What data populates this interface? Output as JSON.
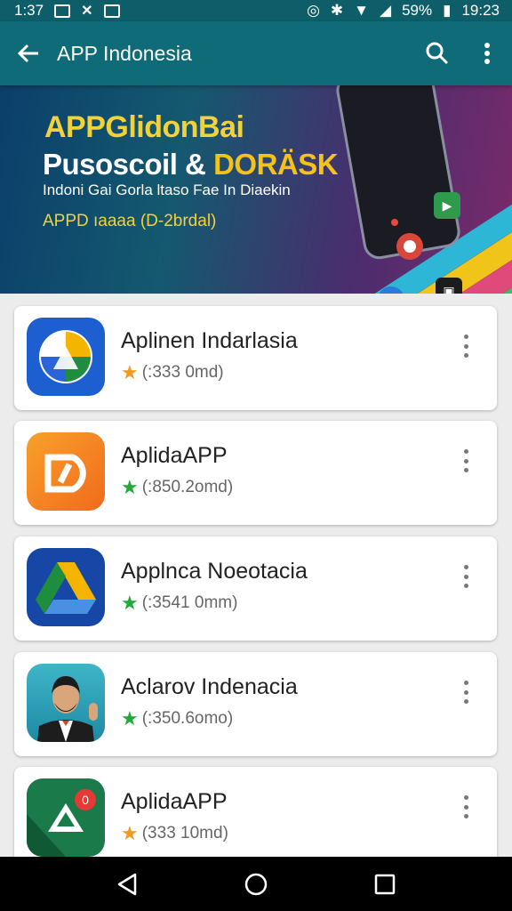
{
  "status_bar": {
    "time_left": "1:37",
    "battery": "59%",
    "clock": "19:23"
  },
  "toolbar": {
    "title": "APP Indonesia",
    "back_icon": "arrow-back-icon",
    "search_icon": "search-icon",
    "more_icon": "more-vert-icon"
  },
  "banner": {
    "line1": "APPGlidonBai",
    "line2_a": "Pusoscoil & ",
    "line2_b": "DORÄSK",
    "line3": "Indoni Gai Gorla ltaso Fae In Diaekin",
    "line4": "APPD ıaaaa (D-2brdal)"
  },
  "apps": [
    {
      "name": "Aplinen Indarlasia",
      "rating_text": "(:333 0md)",
      "star_color": "#f29a1f",
      "icon": "drive-blue-icon"
    },
    {
      "name": "AplidaAPP",
      "rating_text": "(:850.2omd)",
      "star_color": "#1faa3a",
      "icon": "orange-app-icon"
    },
    {
      "name": "Applnca Noeotacia",
      "rating_text": "(:3541 0mm)",
      "star_color": "#1faa3a",
      "icon": "drive-triangle-icon"
    },
    {
      "name": "Aclarov Indenacia",
      "rating_text": "(:350.6omo)",
      "star_color": "#1faa3a",
      "icon": "avatar-man-icon"
    },
    {
      "name": "AplidaAPP",
      "rating_text": "(333 10md)",
      "star_color": "#f29a1f",
      "icon": "green-red-app-icon"
    }
  ],
  "nav": {
    "back": "nav-back-icon",
    "home": "nav-home-icon",
    "recents": "nav-recents-icon"
  }
}
